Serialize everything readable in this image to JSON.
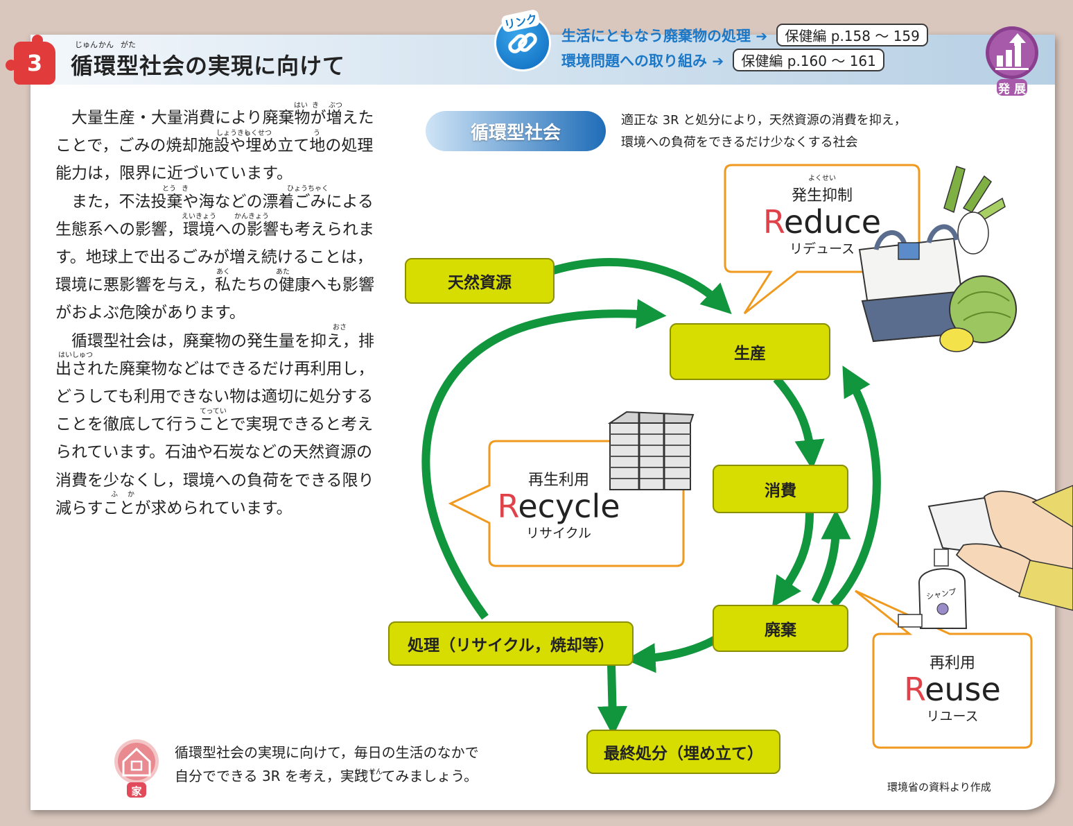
{
  "section": {
    "number": "3",
    "title": "循環型社会の実現に向けて",
    "title_ruby": [
      "じゅん",
      "かん",
      "がた"
    ]
  },
  "links": {
    "badge_label": "リンク",
    "items": [
      {
        "text": "生活にともなう廃棄物の処理",
        "ref": "保健編 p.158 〜 159"
      },
      {
        "text": "環境問題への取り組み",
        "ref": "保健編 p.160 〜 161"
      }
    ]
  },
  "hatten_label": "発 展",
  "body": {
    "paragraphs": [
      "大量生産・大量消費により廃棄物が増えたことで，ごみの焼却施設や埋め立て地の処理能力は，限界に近づいています。",
      "また，不法投棄や海などの漂着ごみによる生態系への影響，環境への影響も考えられます。地球上で出るごみが増え続けることは，環境に悪影響を与え，私たちの健康へも影響がおよぶ危険があります。",
      "循環型社会は，廃棄物の発生量を抑え，排出された廃棄物などはできるだけ再利用し，どうしても利用できない物は適切に処分することを徹底して行うことで実現できると考えられています。石油や石炭などの天然資源の消費を少なくし，環境への負荷をできる限り減らすことが求められています。"
    ],
    "ruby": [
      "はい",
      "き",
      "ぶつ",
      "しょうきゃく",
      "し",
      "せつ",
      "う",
      "とう",
      "き",
      "ひょうちゃく",
      "えいきょう",
      "かんきょう",
      "あく",
      "あた",
      "おさ",
      "はいしゅつ",
      "てってい",
      "ふ",
      "か"
    ]
  },
  "diagram": {
    "label": "循環型社会",
    "definition": [
      "適正な 3R と処分により，天然資源の消費を抑え，",
      "環境への負荷をできるだけ少なくする社会"
    ],
    "nodes": {
      "resource": "天然資源",
      "production": "生産",
      "consumption": "消費",
      "disposal": "廃棄",
      "treatment": "処理（リサイクル，焼却等）",
      "landfill": "最終処分（埋め立て）"
    },
    "callouts": {
      "reduce": {
        "jp": "発生抑制",
        "ruby": "よくせい",
        "initial": "R",
        "rest": "educe",
        "kana": "リデュース"
      },
      "recycle": {
        "jp": "再生利用",
        "initial": "R",
        "rest": "ecycle",
        "kana": "リサイクル"
      },
      "reuse": {
        "jp": "再利用",
        "initial": "R",
        "rest": "euse",
        "kana": "リユース"
      }
    },
    "illustration_labels": {
      "bottle": "シャンプ"
    }
  },
  "home": {
    "label": "家",
    "lines": [
      "循環型社会の実現に向けて，毎日の生活のなかで",
      "自分でできる 3R を考え，実践してみましょう。"
    ],
    "ruby": "じっせん"
  },
  "source": "環境省の資料より作成",
  "colors": {
    "arrow": "#11953d",
    "node_fill": "#d7dd00",
    "callout_border": "#ef9a1e",
    "accent_red": "#e0424a",
    "link_blue": "#1c78c7"
  }
}
